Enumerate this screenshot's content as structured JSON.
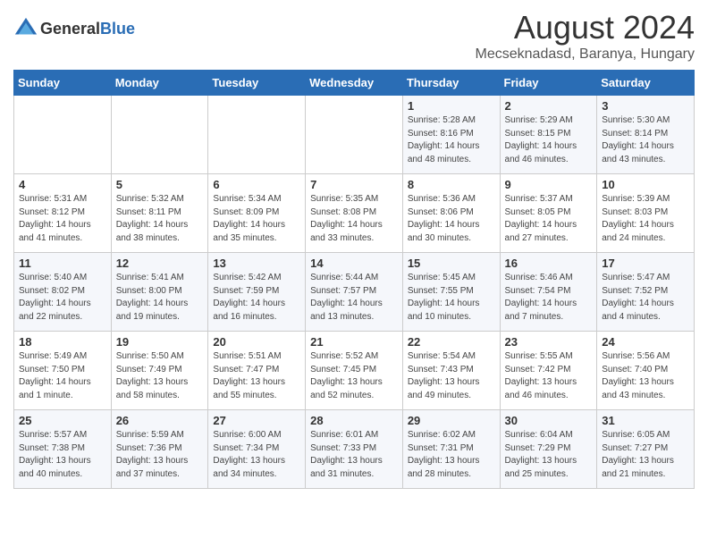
{
  "header": {
    "logo_general": "General",
    "logo_blue": "Blue",
    "month_year": "August 2024",
    "location": "Mecseknadasd, Baranya, Hungary"
  },
  "weekdays": [
    "Sunday",
    "Monday",
    "Tuesday",
    "Wednesday",
    "Thursday",
    "Friday",
    "Saturday"
  ],
  "weeks": [
    [
      {
        "day": "",
        "info": ""
      },
      {
        "day": "",
        "info": ""
      },
      {
        "day": "",
        "info": ""
      },
      {
        "day": "",
        "info": ""
      },
      {
        "day": "1",
        "info": "Sunrise: 5:28 AM\nSunset: 8:16 PM\nDaylight: 14 hours\nand 48 minutes."
      },
      {
        "day": "2",
        "info": "Sunrise: 5:29 AM\nSunset: 8:15 PM\nDaylight: 14 hours\nand 46 minutes."
      },
      {
        "day": "3",
        "info": "Sunrise: 5:30 AM\nSunset: 8:14 PM\nDaylight: 14 hours\nand 43 minutes."
      }
    ],
    [
      {
        "day": "4",
        "info": "Sunrise: 5:31 AM\nSunset: 8:12 PM\nDaylight: 14 hours\nand 41 minutes."
      },
      {
        "day": "5",
        "info": "Sunrise: 5:32 AM\nSunset: 8:11 PM\nDaylight: 14 hours\nand 38 minutes."
      },
      {
        "day": "6",
        "info": "Sunrise: 5:34 AM\nSunset: 8:09 PM\nDaylight: 14 hours\nand 35 minutes."
      },
      {
        "day": "7",
        "info": "Sunrise: 5:35 AM\nSunset: 8:08 PM\nDaylight: 14 hours\nand 33 minutes."
      },
      {
        "day": "8",
        "info": "Sunrise: 5:36 AM\nSunset: 8:06 PM\nDaylight: 14 hours\nand 30 minutes."
      },
      {
        "day": "9",
        "info": "Sunrise: 5:37 AM\nSunset: 8:05 PM\nDaylight: 14 hours\nand 27 minutes."
      },
      {
        "day": "10",
        "info": "Sunrise: 5:39 AM\nSunset: 8:03 PM\nDaylight: 14 hours\nand 24 minutes."
      }
    ],
    [
      {
        "day": "11",
        "info": "Sunrise: 5:40 AM\nSunset: 8:02 PM\nDaylight: 14 hours\nand 22 minutes."
      },
      {
        "day": "12",
        "info": "Sunrise: 5:41 AM\nSunset: 8:00 PM\nDaylight: 14 hours\nand 19 minutes."
      },
      {
        "day": "13",
        "info": "Sunrise: 5:42 AM\nSunset: 7:59 PM\nDaylight: 14 hours\nand 16 minutes."
      },
      {
        "day": "14",
        "info": "Sunrise: 5:44 AM\nSunset: 7:57 PM\nDaylight: 14 hours\nand 13 minutes."
      },
      {
        "day": "15",
        "info": "Sunrise: 5:45 AM\nSunset: 7:55 PM\nDaylight: 14 hours\nand 10 minutes."
      },
      {
        "day": "16",
        "info": "Sunrise: 5:46 AM\nSunset: 7:54 PM\nDaylight: 14 hours\nand 7 minutes."
      },
      {
        "day": "17",
        "info": "Sunrise: 5:47 AM\nSunset: 7:52 PM\nDaylight: 14 hours\nand 4 minutes."
      }
    ],
    [
      {
        "day": "18",
        "info": "Sunrise: 5:49 AM\nSunset: 7:50 PM\nDaylight: 14 hours\nand 1 minute."
      },
      {
        "day": "19",
        "info": "Sunrise: 5:50 AM\nSunset: 7:49 PM\nDaylight: 13 hours\nand 58 minutes."
      },
      {
        "day": "20",
        "info": "Sunrise: 5:51 AM\nSunset: 7:47 PM\nDaylight: 13 hours\nand 55 minutes."
      },
      {
        "day": "21",
        "info": "Sunrise: 5:52 AM\nSunset: 7:45 PM\nDaylight: 13 hours\nand 52 minutes."
      },
      {
        "day": "22",
        "info": "Sunrise: 5:54 AM\nSunset: 7:43 PM\nDaylight: 13 hours\nand 49 minutes."
      },
      {
        "day": "23",
        "info": "Sunrise: 5:55 AM\nSunset: 7:42 PM\nDaylight: 13 hours\nand 46 minutes."
      },
      {
        "day": "24",
        "info": "Sunrise: 5:56 AM\nSunset: 7:40 PM\nDaylight: 13 hours\nand 43 minutes."
      }
    ],
    [
      {
        "day": "25",
        "info": "Sunrise: 5:57 AM\nSunset: 7:38 PM\nDaylight: 13 hours\nand 40 minutes."
      },
      {
        "day": "26",
        "info": "Sunrise: 5:59 AM\nSunset: 7:36 PM\nDaylight: 13 hours\nand 37 minutes."
      },
      {
        "day": "27",
        "info": "Sunrise: 6:00 AM\nSunset: 7:34 PM\nDaylight: 13 hours\nand 34 minutes."
      },
      {
        "day": "28",
        "info": "Sunrise: 6:01 AM\nSunset: 7:33 PM\nDaylight: 13 hours\nand 31 minutes."
      },
      {
        "day": "29",
        "info": "Sunrise: 6:02 AM\nSunset: 7:31 PM\nDaylight: 13 hours\nand 28 minutes."
      },
      {
        "day": "30",
        "info": "Sunrise: 6:04 AM\nSunset: 7:29 PM\nDaylight: 13 hours\nand 25 minutes."
      },
      {
        "day": "31",
        "info": "Sunrise: 6:05 AM\nSunset: 7:27 PM\nDaylight: 13 hours\nand 21 minutes."
      }
    ]
  ]
}
